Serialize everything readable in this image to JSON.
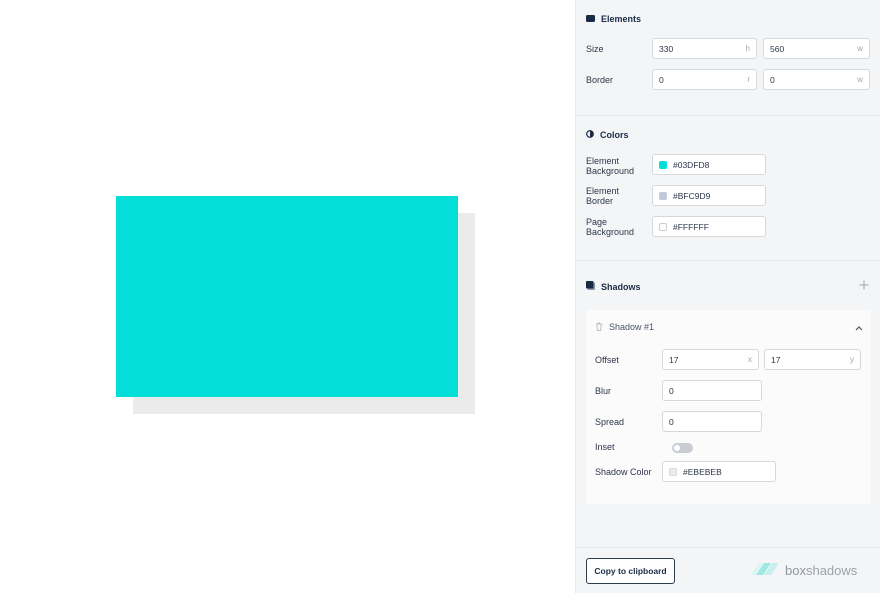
{
  "colors": {
    "element_background": "#03DFD8",
    "shadow": "#EBEBEB",
    "accent": "#1a2b44"
  },
  "elements": {
    "title": "Elements",
    "icon": "rectangle-icon",
    "size_label": "Size",
    "size_h": "330",
    "size_h_unit": "h",
    "size_w": "560",
    "size_w_unit": "w",
    "border_label": "Border",
    "border_r": "0",
    "border_r_unit": "r",
    "border_w": "0",
    "border_w_unit": "w"
  },
  "colors_section": {
    "title": "Colors",
    "icon": "contrast-icon",
    "element_background_label_1": "Element",
    "element_background_label_2": "Background",
    "element_background_value": "#03DFD8",
    "element_border_label_1": "Element",
    "element_border_label_2": "Border",
    "element_border_value": "#BFC9D9",
    "page_background_label_1": "Page",
    "page_background_label_2": "Background",
    "page_background_value": "#FFFFFF"
  },
  "shadows": {
    "title": "Shadows",
    "icon": "layers-icon",
    "add_icon": "plus-icon",
    "items": [
      {
        "title": "Shadow #1",
        "offset_label": "Offset",
        "offset_x": "17",
        "offset_x_unit": "x",
        "offset_y": "17",
        "offset_y_unit": "y",
        "blur_label": "Blur",
        "blur": "0",
        "spread_label": "Spread",
        "spread": "0",
        "inset_label": "Inset",
        "inset": false,
        "shadow_color_label": "Shadow Color",
        "shadow_color_value": "#EBEBEB"
      }
    ]
  },
  "footer": {
    "copy_label": "Copy to clipboard",
    "brand_prefix": "box",
    "brand_suffix": "shadows"
  }
}
